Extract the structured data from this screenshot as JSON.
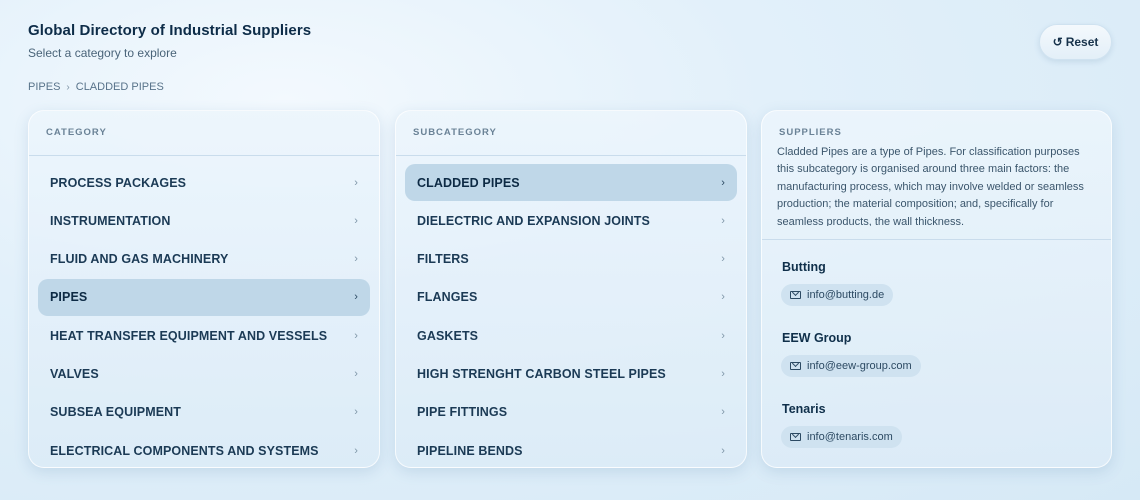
{
  "app": {
    "title": "Global Directory of Industrial Suppliers",
    "subtitle": "Select a category to explore"
  },
  "reset": {
    "icon": "refresh-icon",
    "glyph": "↺",
    "label": "Reset"
  },
  "breadcrumb": {
    "items": [
      "PIPES",
      "CLADDED PIPES"
    ],
    "separator": "›"
  },
  "categories": {
    "label": "CATEGORY",
    "items": [
      {
        "label": "PROCESS PACKAGES",
        "active": false
      },
      {
        "label": "INSTRUMENTATION",
        "active": false
      },
      {
        "label": "FLUID AND GAS MACHINERY",
        "active": false
      },
      {
        "label": "PIPES",
        "active": true
      },
      {
        "label": "HEAT TRANSFER EQUIPMENT AND VESSELS",
        "active": false
      },
      {
        "label": "VALVES",
        "active": false
      },
      {
        "label": "SUBSEA EQUIPMENT",
        "active": false
      },
      {
        "label": "ELECTRICAL COMPONENTS AND SYSTEMS",
        "active": false
      }
    ]
  },
  "subcategories": {
    "label": "SUBCATEGORY",
    "items": [
      {
        "label": "CLADDED PIPES",
        "active": true
      },
      {
        "label": "DIELECTRIC AND EXPANSION JOINTS",
        "active": false
      },
      {
        "label": "FILTERS",
        "active": false
      },
      {
        "label": "FLANGES",
        "active": false
      },
      {
        "label": "GASKETS",
        "active": false
      },
      {
        "label": "HIGH STRENGHT CARBON STEEL PIPES",
        "active": false
      },
      {
        "label": "PIPE FITTINGS",
        "active": false
      },
      {
        "label": "PIPELINE BENDS",
        "active": false
      }
    ]
  },
  "suppliers": {
    "label": "SUPPLIERS",
    "description": "Cladded Pipes are a type of Pipes. For classification purposes this subcategory is organised around three main factors: the manufacturing process, which may involve welded or seamless production; the material composition; and, specifically for seamless products, the wall thickness.",
    "items": [
      {
        "name": "Butting",
        "email": "info@butting.de"
      },
      {
        "name": "EEW Group",
        "email": "info@eew-group.com"
      },
      {
        "name": "Tenaris",
        "email": "info@tenaris.com"
      }
    ]
  },
  "icons": {
    "chevron": "›",
    "email": "mail-icon"
  },
  "colors": {
    "active_row": "#bfd7e8",
    "title": "#0d2c48",
    "email_chip": "#cfe2f0"
  }
}
